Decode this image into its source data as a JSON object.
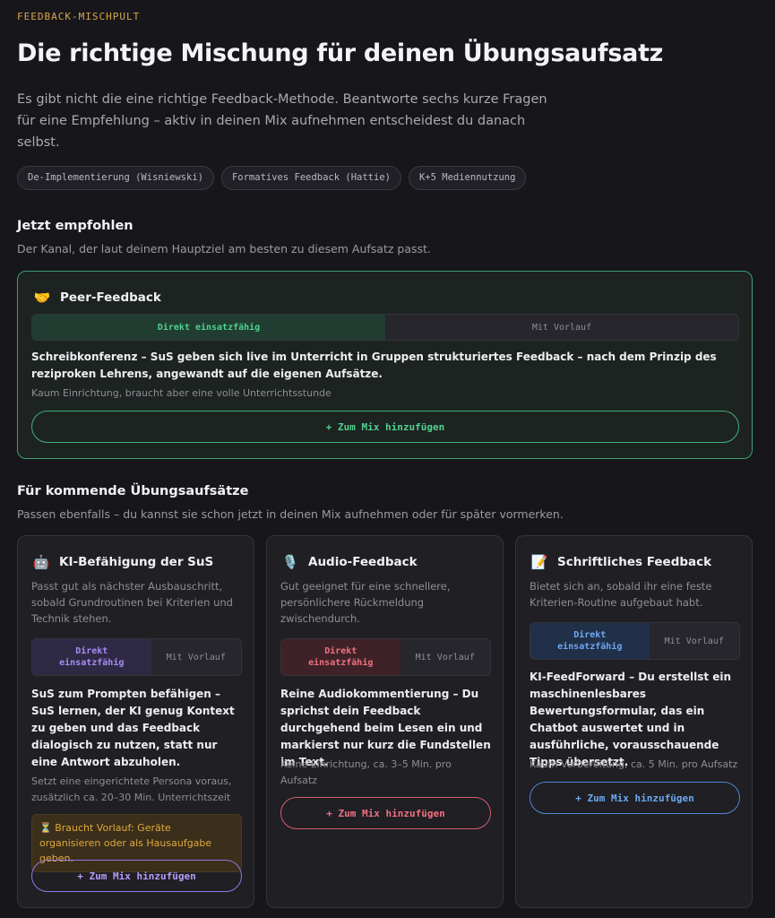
{
  "header": {
    "eyebrow": "FEEDBACK-MISCHPULT",
    "title": "Die richtige Mischung für deinen Übungsaufsatz",
    "intro": "Es gibt nicht die eine richtige Feedback-Methode. Beantworte sechs kurze Fragen für eine Empfehlung – aktiv in deinen Mix aufnehmen entscheidest du danach selbst.",
    "tags": [
      "De-Implementierung (Wisniewski)",
      "Formatives Feedback (Hattie)",
      "K+5 Mediennutzung"
    ]
  },
  "recommended": {
    "heading": "Jetzt empfohlen",
    "subheading": "Der Kanal, der laut deinem Hauptziel am besten zu diesem Aufsatz passt.",
    "card": {
      "icon": "handshake-icon",
      "emoji": "🤝",
      "title": "Peer-Feedback",
      "options": [
        "Direkt einsatzfähig",
        "Mit Vorlauf"
      ],
      "description": "Schreibkonferenz – SuS geben sich live im Unterricht in Gruppen strukturiertes Feedback – nach dem Prinzip des reziproken Lehrens, angewandt auf die eigenen Aufsätze.",
      "note": "Kaum Einrichtung, braucht aber eine volle Unterrichtsstunde",
      "button": "+ Zum Mix hinzufügen"
    }
  },
  "upcoming": {
    "heading": "Für kommende Übungsaufsätze",
    "subheading": "Passen ebenfalls – du kannst sie schon jetzt in deinen Mix aufnehmen oder für später vormerken.",
    "cards": [
      {
        "icon": "robot-icon",
        "emoji": "🤖",
        "title": "KI-Befähigung der SuS",
        "blurb": "Passt gut als nächster Ausbauschritt, sobald Grundroutinen bei Kriterien und Technik stehen.",
        "options": [
          "Direkt einsatzfähig",
          "Mit Vorlauf"
        ],
        "description": "SuS zum Prompten befähigen – SuS lernen, der KI genug Kontext zu geben und das Feedback dialogisch zu nutzen, statt nur eine Antwort abzuholen.",
        "note": "Setzt eine eingerichtete Persona voraus, zusätzlich ca. 20–30 Min. Unterrichtszeit",
        "warning": "⏳ Braucht Vorlauf: Geräte organisieren oder als Hausaufgabe geben.",
        "button": "+ Zum Mix hinzufügen"
      },
      {
        "icon": "microphone-icon",
        "emoji": "🎙️",
        "title": "Audio-Feedback",
        "blurb": "Gut geeignet für eine schnellere, persönlichere Rückmeldung zwischendurch.",
        "options": [
          "Direkt einsatzfähig",
          "Mit Vorlauf"
        ],
        "description": "Reine Audiokommentierung – Du sprichst dein Feedback durchgehend beim Lesen ein und markierst nur kurz die Fundstellen im Text.",
        "note": "Keine Einrichtung, ca. 3–5 Min. pro Aufsatz",
        "button": "+ Zum Mix hinzufügen"
      },
      {
        "icon": "document-pencil-icon",
        "emoji": "📝",
        "title": "Schriftliches Feedback",
        "blurb": "Bietet sich an, sobald ihr eine feste Kriterien-Routine aufgebaut habt.",
        "options": [
          "Direkt einsatzfähig",
          "Mit Vorlauf"
        ],
        "description": "KI-FeedForward – Du erstellst ein maschinenlesbares Bewertungsformular, das ein Chatbot auswertet und in ausführliche, vorausschauende Tipps übersetzt.",
        "note": "Kaum Vorbereitung, ca. 5 Min. pro Aufsatz",
        "button": "+ Zum Mix hinzufügen"
      }
    ]
  }
}
